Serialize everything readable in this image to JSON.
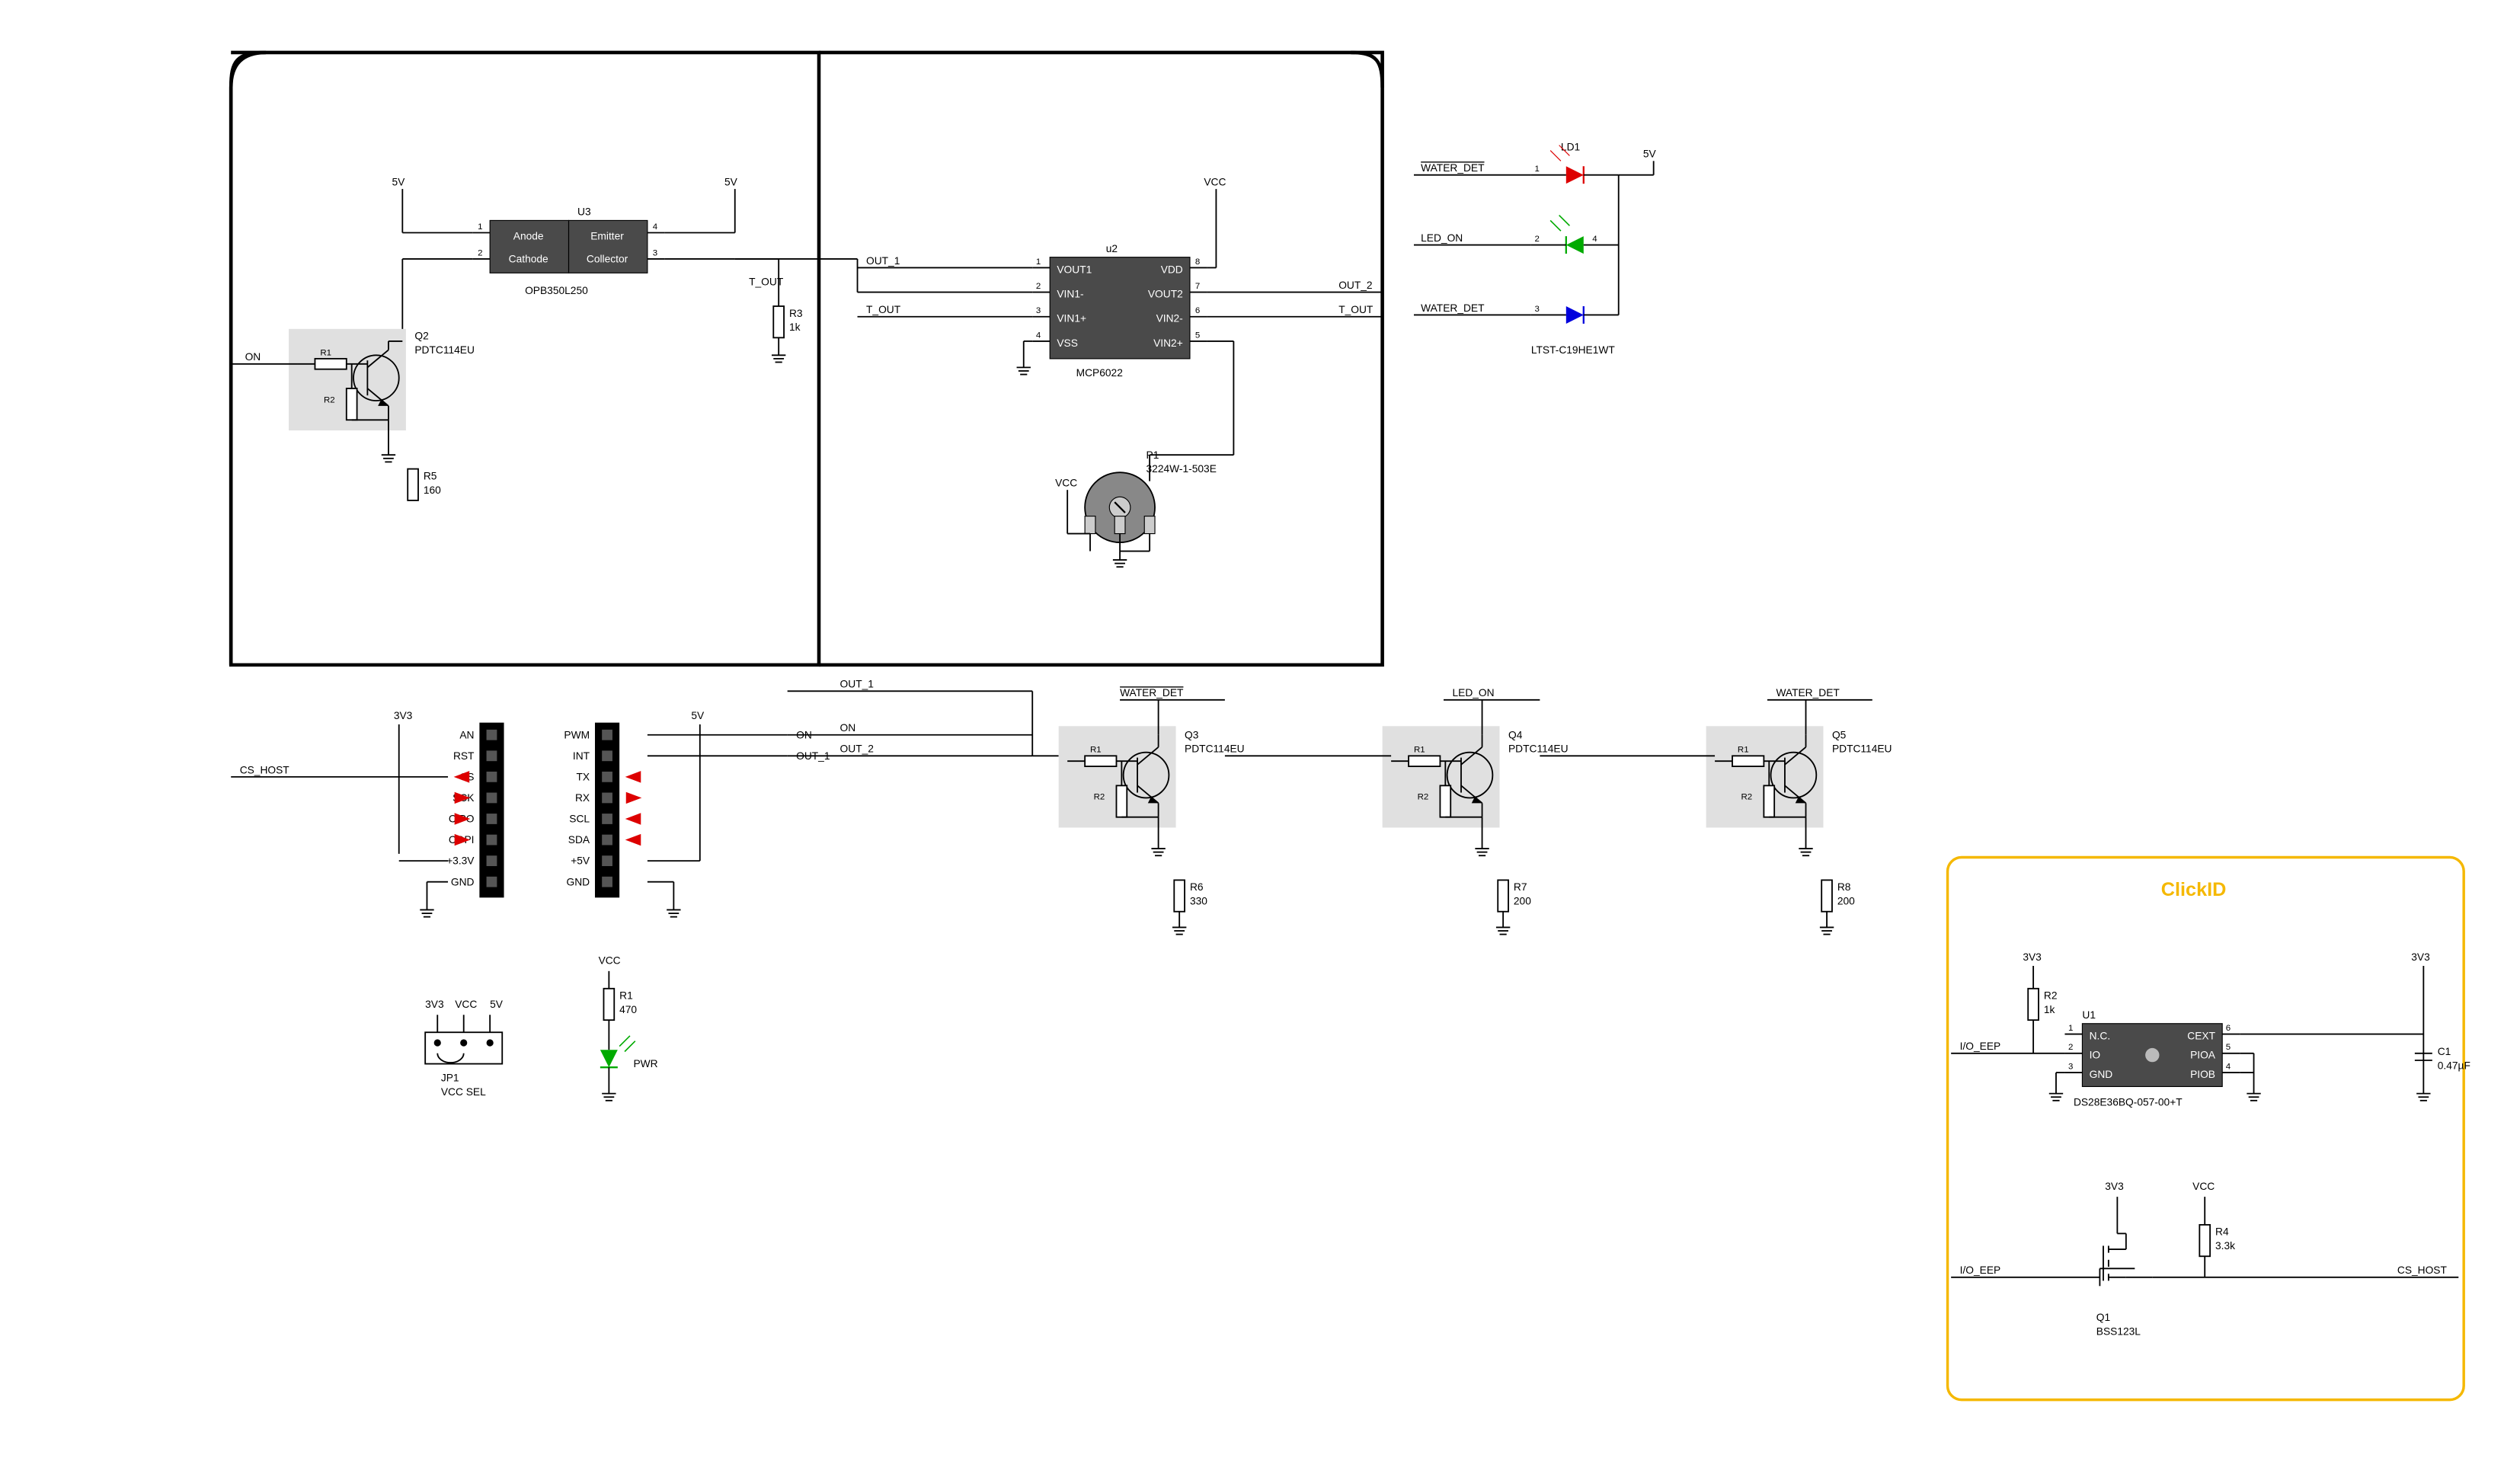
{
  "components": {
    "u3": {
      "ref": "U3",
      "part": "OPB350L250",
      "pins": {
        "1": "Anode",
        "2": "Cathode",
        "3": "Collector",
        "4": "Emitter"
      }
    },
    "u2": {
      "ref": "u2",
      "part": "MCP6022",
      "pins": {
        "1": "VOUT1",
        "2": "VIN1-",
        "3": "VIN1+",
        "4": "VSS",
        "5": "VIN2+",
        "6": "VIN2-",
        "7": "VOUT2",
        "8": "VDD"
      }
    },
    "u1": {
      "ref": "U1",
      "part": "DS28E36BQ-057-00+T",
      "pins": {
        "1": "N.C.",
        "2": "IO",
        "3": "GND",
        "4": "PIOB",
        "5": "PIOA",
        "6": "CEXT"
      }
    },
    "q1": {
      "ref": "Q1",
      "part": "BSS123L"
    },
    "q2": {
      "ref": "Q2",
      "part": "PDTC114EU"
    },
    "q3": {
      "ref": "Q3",
      "part": "PDTC114EU"
    },
    "q4": {
      "ref": "Q4",
      "part": "PDTC114EU"
    },
    "q5": {
      "ref": "Q5",
      "part": "PDTC114EU"
    },
    "p1": {
      "ref": "P1",
      "part": "3224W-1-503E"
    },
    "ld1": {
      "ref": "LD1",
      "part": "LTST-C19HE1WT"
    },
    "pwr": {
      "ref": "PWR"
    },
    "jp1": {
      "ref": "JP1",
      "part": "VCC SEL"
    },
    "r1": {
      "ref": "R1",
      "value": "470"
    },
    "r2": {
      "ref": "R2",
      "value": "1k"
    },
    "r3": {
      "ref": "R3",
      "value": "1k"
    },
    "r4": {
      "ref": "R4",
      "value": "3.3k"
    },
    "r5": {
      "ref": "R5",
      "value": "160"
    },
    "r6": {
      "ref": "R6",
      "value": "330"
    },
    "r7": {
      "ref": "R7",
      "value": "200"
    },
    "r8": {
      "ref": "R8",
      "value": "200"
    },
    "c1": {
      "ref": "C1",
      "value": "0.47µF"
    },
    "r_int1": "R1",
    "r_int2": "R2"
  },
  "nets": {
    "v5": "5V",
    "v3v3": "3V3",
    "vcc": "VCC",
    "on": "ON",
    "t_out": "T_OUT",
    "out_1": "OUT_1",
    "out_2": "OUT_2",
    "water_det": "WATER_DET",
    "water_det_n": "WATER_DET",
    "led_on": "LED_ON",
    "cs_host": "CS_HOST",
    "io_eep": "I/O_EEP"
  },
  "header_left": [
    "AN",
    "RST",
    "CS",
    "SCK",
    "CIPO",
    "COPI",
    "+3.3V",
    "GND"
  ],
  "header_right": [
    "PWM",
    "INT",
    "TX",
    "RX",
    "SCL",
    "SDA",
    "+5V",
    "GND"
  ],
  "clickid_title": "ClickID"
}
